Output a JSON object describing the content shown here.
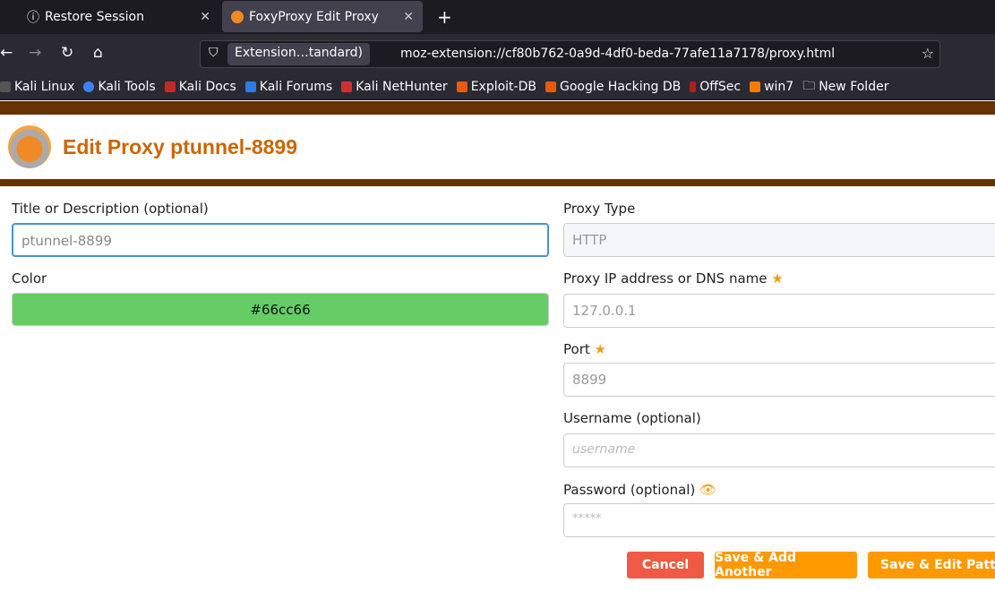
{
  "browser": {
    "tabs": [
      {
        "label": "Restore Session"
      },
      {
        "label": "FoxyProxy Edit Proxy"
      }
    ],
    "identity": "Extension…tandard)",
    "url": "moz-extension://cf80b762-0a9d-4df0-beda-77afe11a7178/proxy.html",
    "bookmarks": [
      "Kali Linux",
      "Kali Tools",
      "Kali Docs",
      "Kali Forums",
      "Kali NetHunter",
      "Exploit-DB",
      "Google Hacking DB",
      "OffSec",
      "win7",
      "New Folder"
    ]
  },
  "page": {
    "title": "Edit Proxy ptunnel-8899",
    "title_label": "Title or Description (optional)",
    "title_value": "ptunnel-8899",
    "color_label": "Color",
    "color_value": "#66cc66",
    "type_label": "Proxy Type",
    "type_value": "HTTP",
    "ip_label": "Proxy IP address or DNS name",
    "ip_value": "127.0.0.1",
    "port_label": "Port",
    "port_value": "8899",
    "user_label": "Username (optional)",
    "user_placeholder": "username",
    "pass_label": "Password (optional)",
    "pass_placeholder": "*****",
    "cancel": "Cancel",
    "save_add": "Save & Add Another",
    "save_edit": "Save & Edit Patterns"
  },
  "colors": {
    "brand": "#cc6600",
    "accent": "#ff9900",
    "cancel": "#ee5a44",
    "bar": "#663300"
  }
}
